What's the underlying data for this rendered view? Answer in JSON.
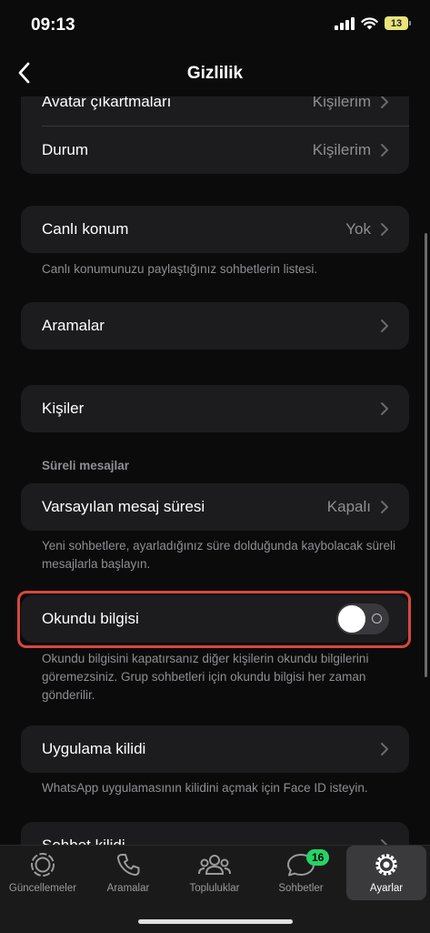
{
  "status": {
    "time": "09:13",
    "battery": "13"
  },
  "nav": {
    "title": "Gizlilik"
  },
  "rows": {
    "avatar": {
      "label": "Avatar çıkartmaları",
      "value": "Kişilerim"
    },
    "durum": {
      "label": "Durum",
      "value": "Kişilerim"
    },
    "canli_konum": {
      "label": "Canlı konum",
      "value": "Yok",
      "note": "Canlı konumunuzu paylaştığınız sohbetlerin listesi."
    },
    "aramalar": {
      "label": "Aramalar"
    },
    "kisiler": {
      "label": "Kişiler"
    },
    "sureli": {
      "header": "Süreli mesajlar",
      "label": "Varsayılan mesaj süresi",
      "value": "Kapalı",
      "note": "Yeni sohbetlere, ayarladığınız süre dolduğunda kaybolacak süreli mesajlarla başlayın."
    },
    "okundu": {
      "label": "Okundu bilgisi",
      "enabled": false,
      "note": "Okundu bilgisini kapatırsanız diğer kişilerin okundu bilgilerini göremezsiniz. Grup sohbetleri için okundu bilgisi her zaman gönderilir."
    },
    "uygulama_kilidi": {
      "label": "Uygulama kilidi",
      "note": "WhatsApp uygulamasının kilidini açmak için Face ID isteyin."
    },
    "sohbet_kilidi": {
      "label": "Sohbet kilidi"
    }
  },
  "tabs": [
    {
      "label": "Güncellemeler",
      "icon": "updates-icon"
    },
    {
      "label": "Aramalar",
      "icon": "phone-icon"
    },
    {
      "label": "Topluluklar",
      "icon": "communities-icon"
    },
    {
      "label": "Sohbetler",
      "icon": "chats-icon",
      "badge": "16"
    },
    {
      "label": "Ayarlar",
      "icon": "settings-gear-icon",
      "active": true
    }
  ],
  "colors": {
    "accent": "#25d366",
    "highlight": "#d9473d"
  }
}
